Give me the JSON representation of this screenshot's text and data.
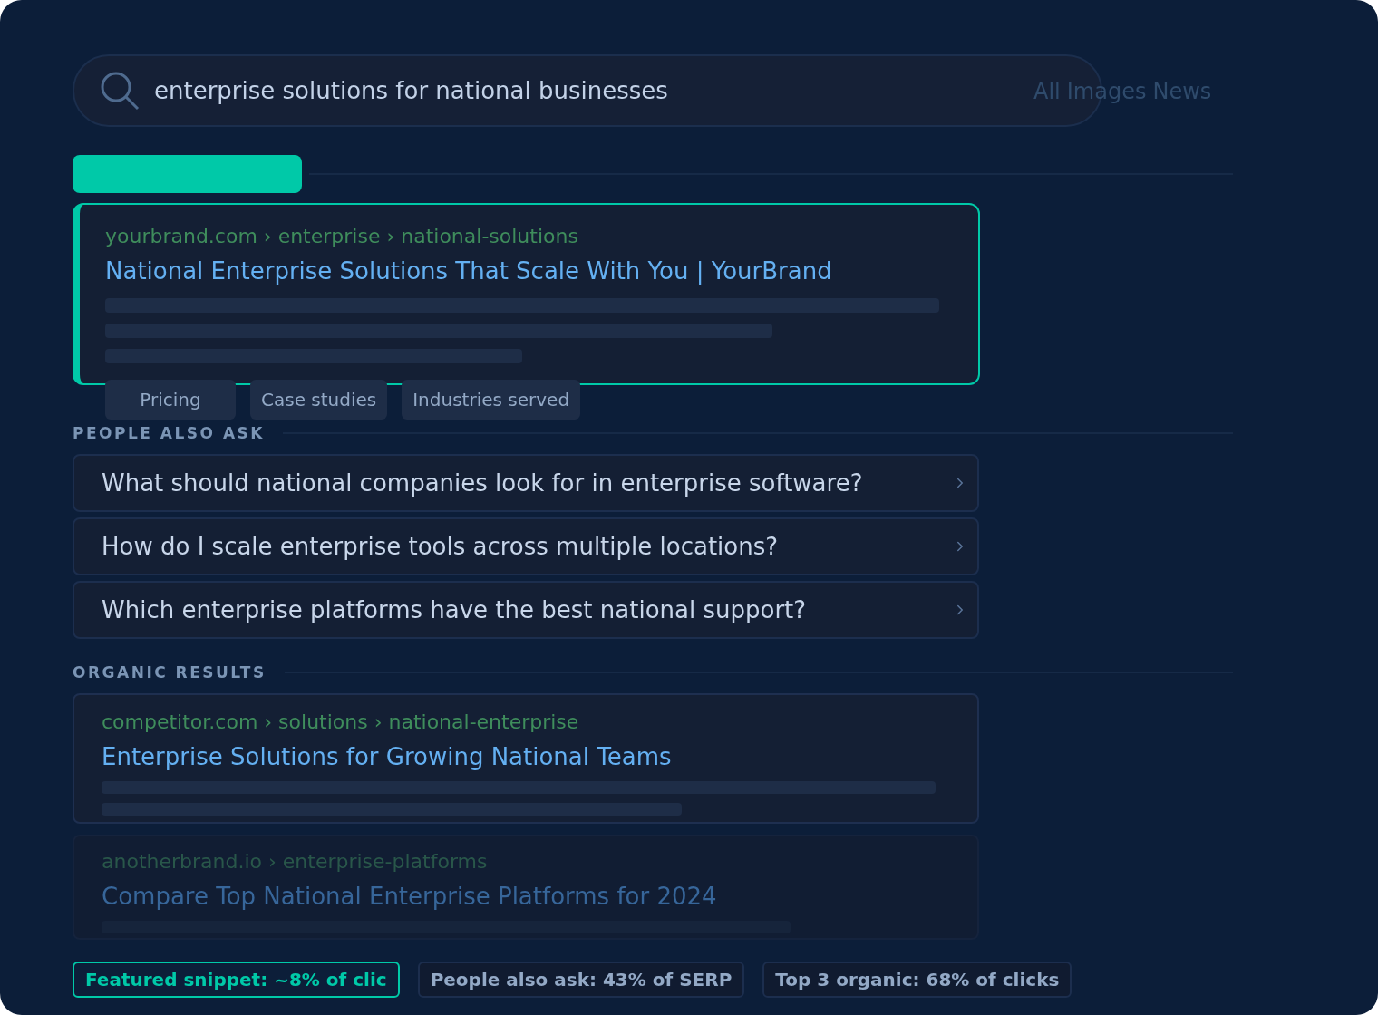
{
  "search": {
    "query": "enterprise solutions for national businesses",
    "tabs": [
      {
        "label": "All"
      },
      {
        "label": "Images"
      },
      {
        "label": "News"
      }
    ]
  },
  "featured_snippet": {
    "breadcrumb": "yourbrand.com › enterprise › national-solutions",
    "title": "National Enterprise Solutions That Scale With You | YourBrand",
    "sitelinks": [
      "Pricing",
      "Case studies",
      "Industries served"
    ]
  },
  "people_also_ask": {
    "heading": "PEOPLE ALSO ASK",
    "questions": [
      "What should national companies look for in enterprise software?",
      "How do I scale enterprise tools across multiple locations?",
      "Which enterprise platforms have the best national support?"
    ]
  },
  "organic_results": {
    "heading": "ORGANIC RESULTS",
    "results": [
      {
        "breadcrumb": "competitor.com › solutions › national-enterprise",
        "title": "Enterprise Solutions for Growing National Teams",
        "faded": false
      },
      {
        "breadcrumb": "anotherbrand.io › enterprise-platforms",
        "title": "Compare Top National Enterprise Platforms for 2024",
        "faded": true
      }
    ]
  },
  "stats": [
    {
      "label": "Featured snippet: ~8% of clic",
      "highlighted": true
    },
    {
      "label": "People also ask: 43% of SERP",
      "highlighted": false
    },
    {
      "label": "Top 3 organic: 68% of clicks",
      "highlighted": false
    }
  ]
}
